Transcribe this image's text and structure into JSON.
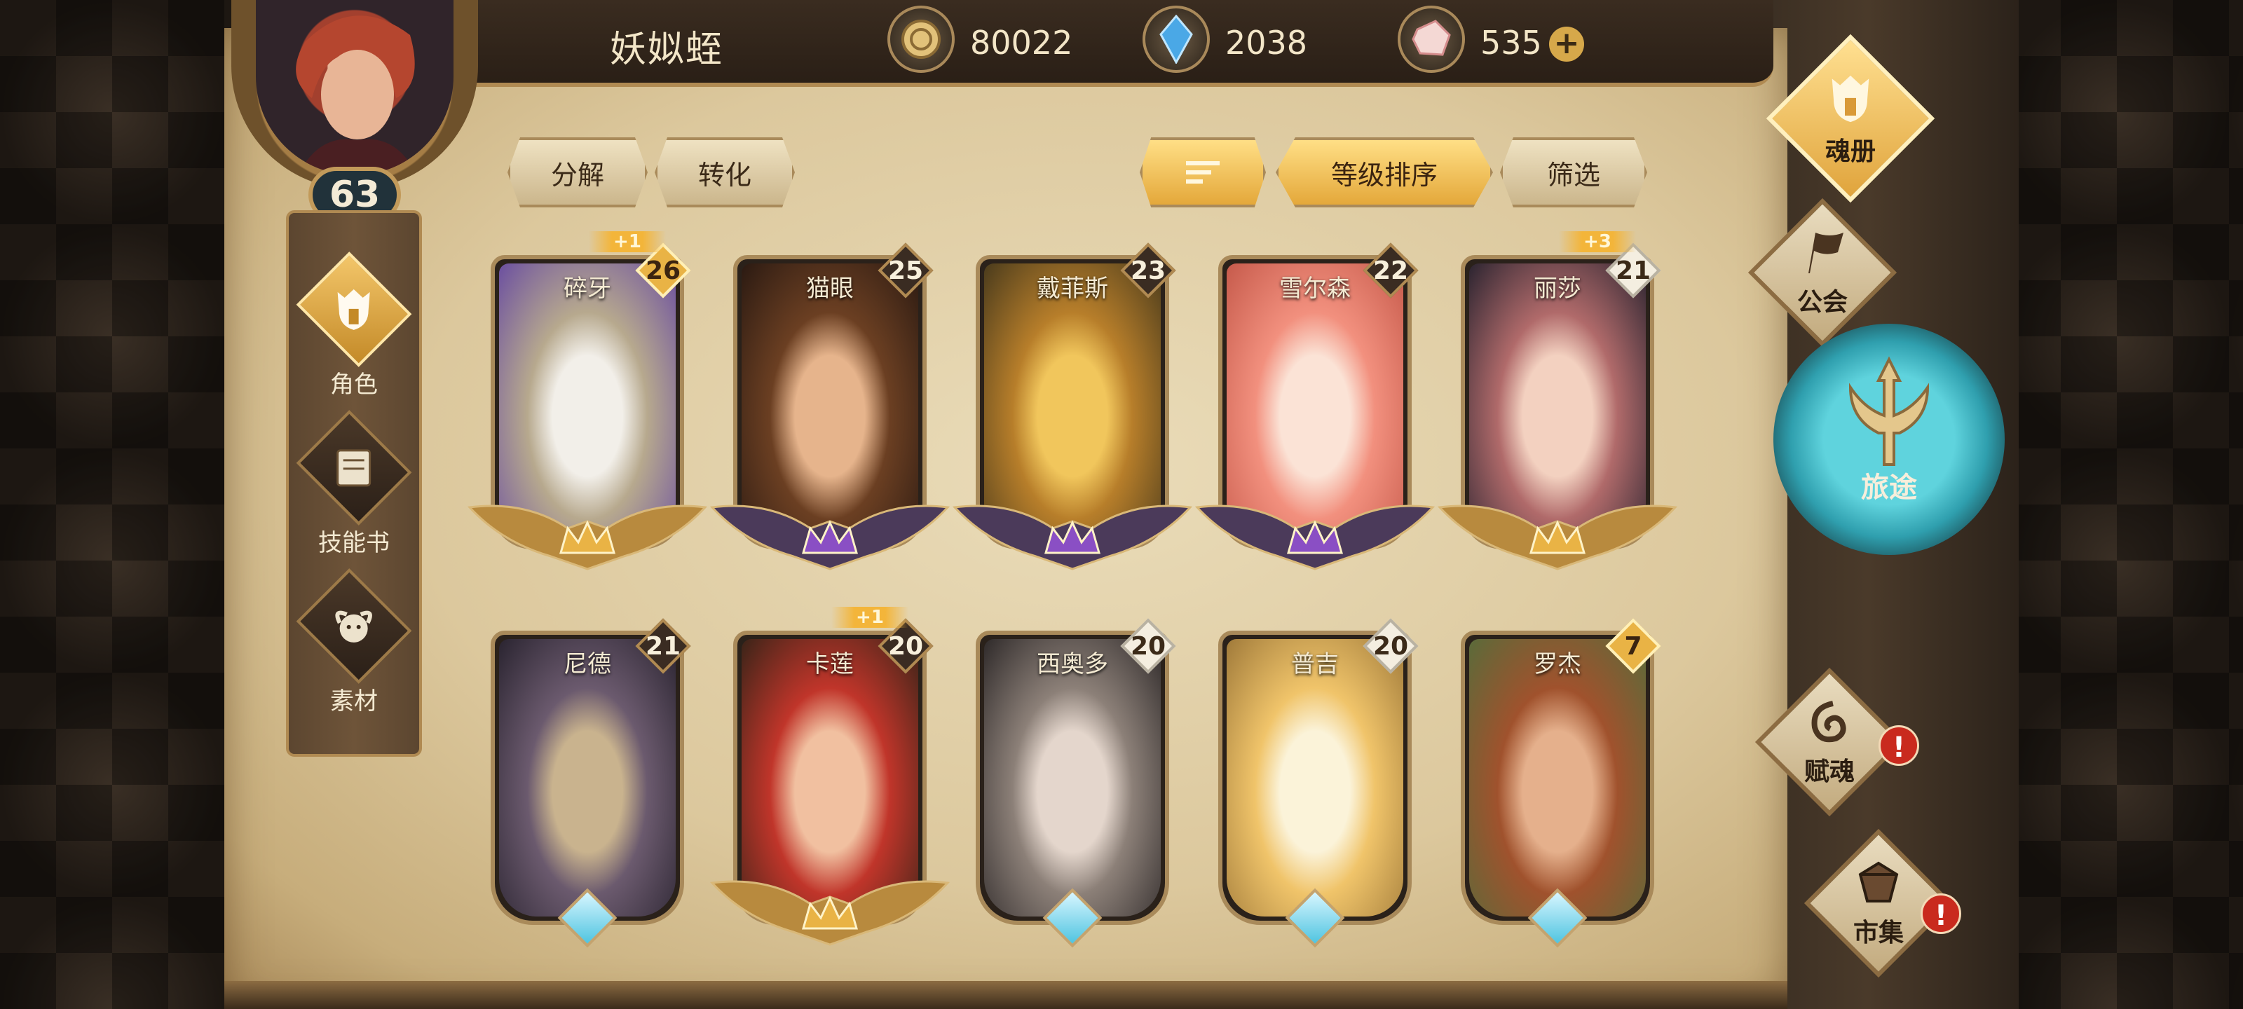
{
  "player": {
    "name": "妖姒蛭",
    "level": "63"
  },
  "resources": [
    {
      "icon": "gold-coin-icon",
      "value": "80022"
    },
    {
      "icon": "blue-crystal-icon",
      "value": "2038"
    },
    {
      "icon": "pink-gem-icon",
      "value": "535"
    }
  ],
  "resource_plus": "+",
  "left_nav": [
    {
      "label": "角色",
      "icon": "helmet-icon",
      "active": true
    },
    {
      "label": "技能书",
      "icon": "book-icon",
      "active": false
    },
    {
      "label": "素材",
      "icon": "material-icon",
      "active": false
    }
  ],
  "actions": {
    "decompose": "分解",
    "convert": "转化",
    "sort_level": "等级排序",
    "filter": "筛选"
  },
  "cards": [
    {
      "name": "碎牙",
      "level": "26",
      "plus": "+1",
      "badge": "gold",
      "rank": "gold",
      "art": [
        "#f2efe9",
        "#b7a98e",
        "#6b4fa0"
      ]
    },
    {
      "name": "猫眼",
      "level": "25",
      "plus": "",
      "badge": "dark",
      "rank": "purple",
      "art": [
        "#e6b48c",
        "#6b3f22",
        "#2b1a12"
      ]
    },
    {
      "name": "戴菲斯",
      "level": "23",
      "plus": "",
      "badge": "dark",
      "rank": "purple",
      "art": [
        "#f1c65c",
        "#b77e2a",
        "#4a3b1c"
      ]
    },
    {
      "name": "雪尔森",
      "level": "22",
      "plus": "",
      "badge": "dark",
      "rank": "purple",
      "art": [
        "#fbe3d6",
        "#f2907e",
        "#c65a4b"
      ]
    },
    {
      "name": "丽莎",
      "level": "21",
      "plus": "+3",
      "badge": "white",
      "rank": "gold",
      "art": [
        "#f3d1c0",
        "#b06a6a",
        "#2b2430"
      ]
    },
    {
      "name": "尼德",
      "level": "21",
      "plus": "",
      "badge": "dark",
      "rank": "blue",
      "art": [
        "#c9b38e",
        "#6b5a6e",
        "#2a2430"
      ]
    },
    {
      "name": "卡莲",
      "level": "20",
      "plus": "+1",
      "badge": "dark",
      "rank": "gold",
      "art": [
        "#f1c0a0",
        "#c0352a",
        "#3a2418"
      ]
    },
    {
      "name": "西奥多",
      "level": "20",
      "plus": "",
      "badge": "white",
      "rank": "blue",
      "art": [
        "#e4d6cc",
        "#8c8078",
        "#2f2a2a"
      ]
    },
    {
      "name": "普吉",
      "level": "20",
      "plus": "",
      "badge": "white",
      "rank": "blue",
      "art": [
        "#fbf3d9",
        "#f0c46a",
        "#a07a3a"
      ]
    },
    {
      "name": "罗杰",
      "level": "7",
      "plus": "",
      "badge": "gold",
      "rank": "blue",
      "art": [
        "#e5b08c",
        "#a0522d",
        "#5a6b3a"
      ]
    }
  ],
  "right_nav": {
    "soul_book": "魂册",
    "guild": "公会",
    "journey": "旅途",
    "empower": "赋魂",
    "market": "市集",
    "alert": "!"
  },
  "colors": {
    "gold": "#e9b345",
    "purple": "#8a4fc4",
    "blue": "#4fc4e0",
    "parchment": "#dcc89d"
  }
}
